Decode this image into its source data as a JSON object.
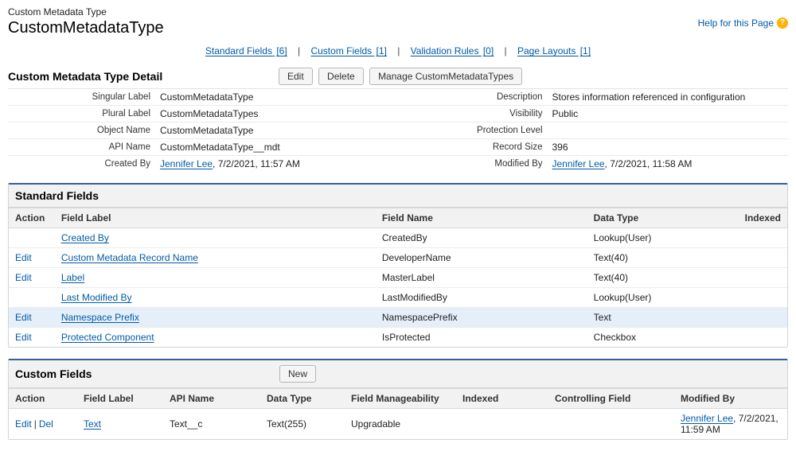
{
  "header": {
    "pretitle": "Custom Metadata Type",
    "title": "CustomMetadataType",
    "help": "Help for this Page"
  },
  "anchors": {
    "std": {
      "label": "Standard Fields",
      "count": "[6]"
    },
    "cust": {
      "label": "Custom Fields",
      "count": "[1]"
    },
    "val": {
      "label": "Validation Rules",
      "count": "[0]"
    },
    "lay": {
      "label": "Page Layouts",
      "count": "[1]"
    }
  },
  "detailSection": {
    "title": "Custom Metadata Type Detail",
    "buttons": {
      "edit": "Edit",
      "delete": "Delete",
      "manage": "Manage CustomMetadataTypes"
    },
    "labels": {
      "singular": "Singular Label",
      "plural": "Plural Label",
      "object": "Object Name",
      "api": "API Name",
      "created": "Created By",
      "desc": "Description",
      "vis": "Visibility",
      "prot": "Protection Level",
      "size": "Record Size",
      "mod": "Modified By"
    },
    "values": {
      "singular": "CustomMetadataType",
      "plural": "CustomMetadataTypes",
      "object": "CustomMetadataType",
      "api": "CustomMetadataType__mdt",
      "createdUser": "Jennifer Lee",
      "createdDate": ", 7/2/2021, 11:57 AM",
      "desc": "Stores information referenced in configuration",
      "vis": "Public",
      "prot": "",
      "size": "396",
      "modUser": "Jennifer Lee",
      "modDate": ", 7/2/2021, 11:58 AM"
    }
  },
  "standardFields": {
    "title": "Standard Fields",
    "cols": {
      "action": "Action",
      "label": "Field Label",
      "name": "Field Name",
      "type": "Data Type",
      "indexed": "Indexed"
    },
    "actions": {
      "edit": "Edit"
    },
    "rows": [
      {
        "edit": false,
        "label": "Created By",
        "name": "CreatedBy",
        "type": "Lookup(User)",
        "hi": false
      },
      {
        "edit": true,
        "label": "Custom Metadata Record Name",
        "name": "DeveloperName",
        "type": "Text(40)",
        "hi": false
      },
      {
        "edit": true,
        "label": "Label",
        "name": "MasterLabel",
        "type": "Text(40)",
        "hi": false
      },
      {
        "edit": false,
        "label": "Last Modified By",
        "name": "LastModifiedBy",
        "type": "Lookup(User)",
        "hi": false
      },
      {
        "edit": true,
        "label": "Namespace Prefix",
        "name": "NamespacePrefix",
        "type": "Text",
        "hi": true
      },
      {
        "edit": true,
        "label": "Protected Component",
        "name": "IsProtected",
        "type": "Checkbox",
        "hi": false
      }
    ]
  },
  "customFields": {
    "title": "Custom Fields",
    "newBtn": "New",
    "cols": {
      "action": "Action",
      "label": "Field Label",
      "api": "API Name",
      "type": "Data Type",
      "mgmt": "Field Manageability",
      "indexed": "Indexed",
      "ctrl": "Controlling Field",
      "mod": "Modified By"
    },
    "actions": {
      "edit": "Edit",
      "del": "Del"
    },
    "rows": [
      {
        "label": "Text",
        "api": "Text__c",
        "type": "Text(255)",
        "mgmt": "Upgradable",
        "indexed": "",
        "ctrl": "",
        "modUser": "Jennifer Lee",
        "modDate": ", 7/2/2021, 11:59 AM"
      }
    ]
  }
}
